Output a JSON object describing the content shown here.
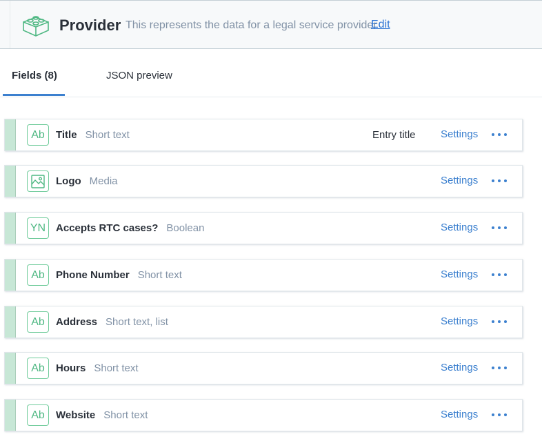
{
  "header": {
    "title": "Provider",
    "description": "This represents the data for a legal service provider",
    "edit_label": "Edit",
    "icon": "content-type-block-icon"
  },
  "tabs": [
    {
      "label": "Fields (8)",
      "active": true
    },
    {
      "label": "JSON preview",
      "active": false
    }
  ],
  "fields": [
    {
      "name": "Title",
      "type": "Short text",
      "icon": "Ab",
      "badge": "Entry title",
      "settings_label": "Settings"
    },
    {
      "name": "Logo",
      "type": "Media",
      "icon": "media",
      "badge": "",
      "settings_label": "Settings"
    },
    {
      "name": "Accepts RTC cases?",
      "type": "Boolean",
      "icon": "YN",
      "badge": "",
      "settings_label": "Settings"
    },
    {
      "name": "Phone Number",
      "type": "Short text",
      "icon": "Ab",
      "badge": "",
      "settings_label": "Settings"
    },
    {
      "name": "Address",
      "type": "Short text, list",
      "icon": "Ab",
      "badge": "",
      "settings_label": "Settings"
    },
    {
      "name": "Hours",
      "type": "Short text",
      "icon": "Ab",
      "badge": "",
      "settings_label": "Settings"
    },
    {
      "name": "Website",
      "type": "Short text",
      "icon": "Ab",
      "badge": "",
      "settings_label": "Settings"
    }
  ],
  "colors": {
    "accent": "#3c80cf",
    "icon_green": "#4fb883",
    "handle_green": "#c7e7d6"
  }
}
